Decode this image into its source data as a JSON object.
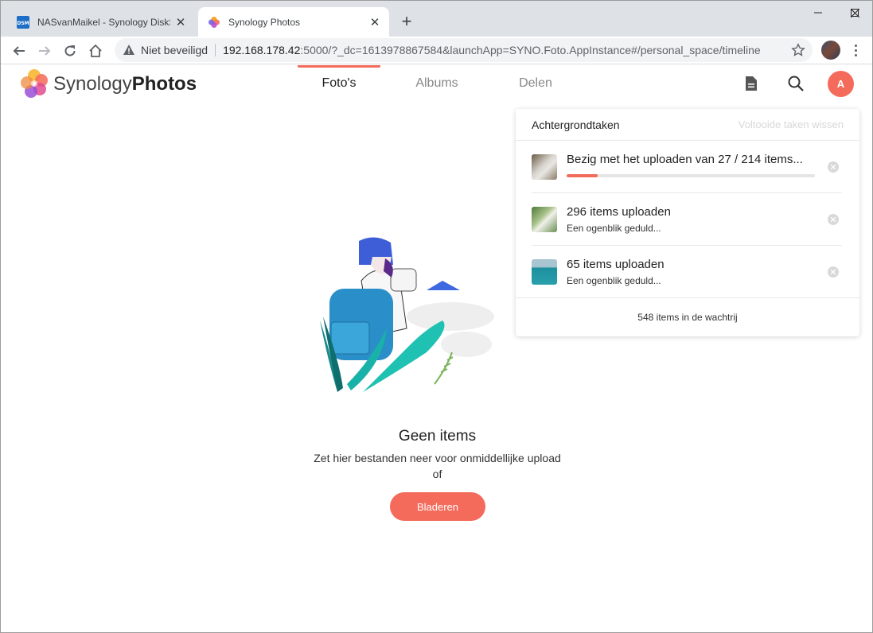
{
  "browser": {
    "tabs": [
      {
        "title": "NASvanMaikel - Synology DiskSt",
        "favicon_text": "DSM",
        "active": false
      },
      {
        "title": "Synology Photos",
        "active": true
      }
    ],
    "security_label": "Niet beveiligd",
    "url_host": "192.168.178.42",
    "url_rest": ":5000/?_dc=1613978867584&launchApp=SYNO.Foto.AppInstance#/personal_space/timeline"
  },
  "app": {
    "brand_light": "Synology",
    "brand_bold": "Photos",
    "nav": [
      {
        "label": "Foto's",
        "active": true
      },
      {
        "label": "Albums",
        "active": false
      },
      {
        "label": "Delen",
        "active": false
      }
    ],
    "avatar_initial": "A",
    "accent_color": "#f46b5b"
  },
  "empty_state": {
    "title": "Geen items",
    "subtitle": "Zet hier bestanden neer voor onmiddellijke upload",
    "or_text": "of",
    "browse_label": "Bladeren"
  },
  "tasks_panel": {
    "title": "Achtergrondtaken",
    "clear_label": "Voltooide taken wissen",
    "tasks": [
      {
        "title": "Bezig met het uploaden van 27 / 214 items...",
        "progress": 0.126,
        "subtitle": ""
      },
      {
        "title": "296 items uploaden",
        "subtitle": "Een ogenblik geduld..."
      },
      {
        "title": "65 items uploaden",
        "subtitle": "Een ogenblik geduld..."
      }
    ],
    "footer": "548 items in de wachtrij"
  }
}
